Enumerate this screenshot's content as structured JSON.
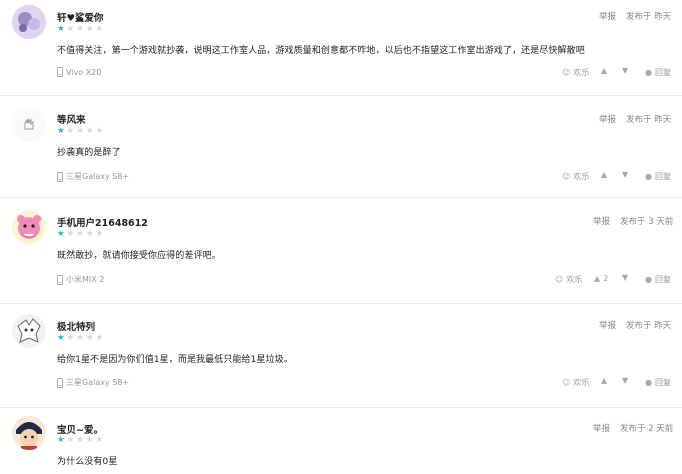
{
  "reviews": [
    {
      "username": "轩♥鲨爱你",
      "stars_filled": 1,
      "stars_total": 5,
      "content": "不值得关注，第一个游戏就抄袭，说明这工作室人品，游戏质量和创意都不咋地，以后也不指望这工作室出游戏了，还是尽快解散吧",
      "device": "Vivo X20",
      "report_label": "举报",
      "time_label": "发布于 昨天",
      "like_label": "欢乐",
      "upvotes": "",
      "reply_label": "回复",
      "avatar_color": "#b8a7d8"
    },
    {
      "username": "等风来",
      "stars_filled": 1,
      "stars_total": 5,
      "content": "抄袭真的是醉了",
      "device": "三星Galaxy S8+",
      "report_label": "举报",
      "time_label": "发布于 昨天",
      "like_label": "欢乐",
      "upvotes": "",
      "reply_label": "回复",
      "avatar_color": "#f2f2f2"
    },
    {
      "username": "手机用户21648612",
      "stars_filled": 1,
      "stars_total": 5,
      "content": "既然敢抄，就请你接受你应得的差评吧。",
      "device": "小米MIX 2",
      "report_label": "举报",
      "time_label": "发布于 3 天前",
      "like_label": "欢乐",
      "upvotes": "2",
      "reply_label": "回复",
      "avatar_color": "#f7a3c8"
    },
    {
      "username": "极北特列",
      "stars_filled": 1,
      "stars_total": 5,
      "content": "给你1星不是因为你们值1星，而是我最低只能给1星垃圾。",
      "device": "三星Galaxy S8+",
      "report_label": "举报",
      "time_label": "发布于 昨天",
      "like_label": "欢乐",
      "upvotes": "",
      "reply_label": "回复",
      "avatar_color": "#e6e6e6"
    },
    {
      "username": "宝贝~爱。",
      "stars_filled": 1,
      "stars_total": 5,
      "content": "为什么没有0星",
      "device": "",
      "report_label": "举报",
      "time_label": "发布于 2 天前",
      "like_label": "",
      "upvotes": "",
      "reply_label": "",
      "avatar_color": "#c73a3a"
    }
  ],
  "colors": {
    "star_on": "#22b8cf",
    "star_off": "#d6d6d6",
    "meta_text": "#888888"
  }
}
